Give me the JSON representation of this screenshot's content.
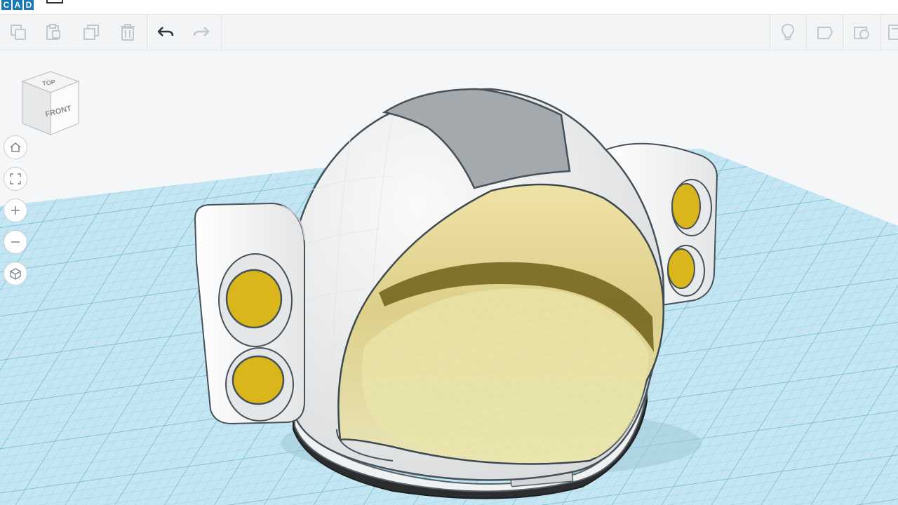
{
  "app": {
    "logo_letters": [
      "C",
      "A",
      "D"
    ],
    "accent_color": "#1a77b5"
  },
  "toolbar": {
    "left_icons": [
      "copy-icon",
      "paste-icon",
      "duplicate-icon",
      "delete-icon",
      "undo-icon",
      "redo-icon"
    ],
    "right_icons": [
      "lightbulb-icon",
      "note-icon",
      "shape-icon",
      "panel-icon"
    ]
  },
  "viewcube": {
    "top_label": "TOP",
    "front_label": "FRONT"
  },
  "nav": {
    "buttons": [
      "home-view-icon",
      "fit-view-icon",
      "zoom-in-icon",
      "zoom-out-icon",
      "perspective-icon"
    ]
  },
  "scene": {
    "workplane_color": "#bfe2ef",
    "grid_color": "#7fc3da",
    "helmet_color": "#f1f2f2",
    "visor_color": "#e7dc9c",
    "stripe_color": "#a3a9ad",
    "light_color": "#d9b71c",
    "base_color": "#2b2d2f"
  }
}
